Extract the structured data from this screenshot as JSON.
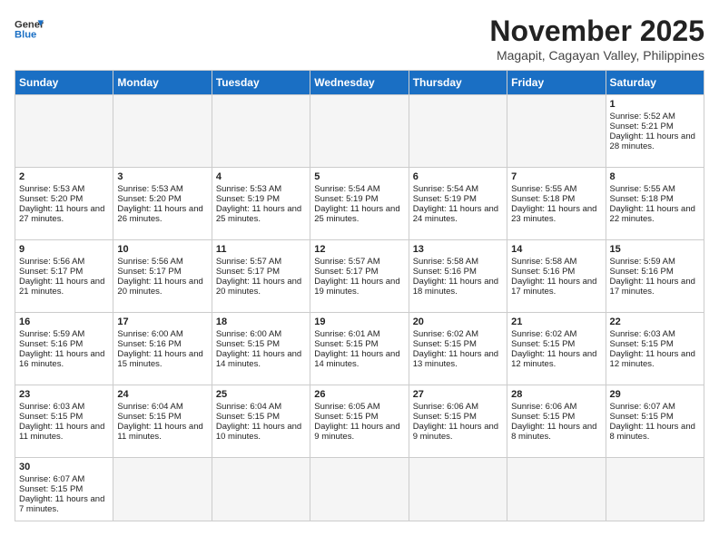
{
  "header": {
    "logo_general": "General",
    "logo_blue": "Blue",
    "month_year": "November 2025",
    "location": "Magapit, Cagayan Valley, Philippines"
  },
  "days_of_week": [
    "Sunday",
    "Monday",
    "Tuesday",
    "Wednesday",
    "Thursday",
    "Friday",
    "Saturday"
  ],
  "weeks": [
    [
      {
        "day": "",
        "empty": true
      },
      {
        "day": "",
        "empty": true
      },
      {
        "day": "",
        "empty": true
      },
      {
        "day": "",
        "empty": true
      },
      {
        "day": "",
        "empty": true
      },
      {
        "day": "",
        "empty": true
      },
      {
        "day": "1",
        "sunrise": "5:52 AM",
        "sunset": "5:21 PM",
        "daylight": "11 hours and 28 minutes."
      }
    ],
    [
      {
        "day": "2",
        "sunrise": "5:53 AM",
        "sunset": "5:20 PM",
        "daylight": "11 hours and 27 minutes."
      },
      {
        "day": "3",
        "sunrise": "5:53 AM",
        "sunset": "5:20 PM",
        "daylight": "11 hours and 26 minutes."
      },
      {
        "day": "4",
        "sunrise": "5:53 AM",
        "sunset": "5:19 PM",
        "daylight": "11 hours and 25 minutes."
      },
      {
        "day": "5",
        "sunrise": "5:54 AM",
        "sunset": "5:19 PM",
        "daylight": "11 hours and 25 minutes."
      },
      {
        "day": "6",
        "sunrise": "5:54 AM",
        "sunset": "5:19 PM",
        "daylight": "11 hours and 24 minutes."
      },
      {
        "day": "7",
        "sunrise": "5:55 AM",
        "sunset": "5:18 PM",
        "daylight": "11 hours and 23 minutes."
      },
      {
        "day": "8",
        "sunrise": "5:55 AM",
        "sunset": "5:18 PM",
        "daylight": "11 hours and 22 minutes."
      }
    ],
    [
      {
        "day": "9",
        "sunrise": "5:56 AM",
        "sunset": "5:17 PM",
        "daylight": "11 hours and 21 minutes."
      },
      {
        "day": "10",
        "sunrise": "5:56 AM",
        "sunset": "5:17 PM",
        "daylight": "11 hours and 20 minutes."
      },
      {
        "day": "11",
        "sunrise": "5:57 AM",
        "sunset": "5:17 PM",
        "daylight": "11 hours and 20 minutes."
      },
      {
        "day": "12",
        "sunrise": "5:57 AM",
        "sunset": "5:17 PM",
        "daylight": "11 hours and 19 minutes."
      },
      {
        "day": "13",
        "sunrise": "5:58 AM",
        "sunset": "5:16 PM",
        "daylight": "11 hours and 18 minutes."
      },
      {
        "day": "14",
        "sunrise": "5:58 AM",
        "sunset": "5:16 PM",
        "daylight": "11 hours and 17 minutes."
      },
      {
        "day": "15",
        "sunrise": "5:59 AM",
        "sunset": "5:16 PM",
        "daylight": "11 hours and 17 minutes."
      }
    ],
    [
      {
        "day": "16",
        "sunrise": "5:59 AM",
        "sunset": "5:16 PM",
        "daylight": "11 hours and 16 minutes."
      },
      {
        "day": "17",
        "sunrise": "6:00 AM",
        "sunset": "5:16 PM",
        "daylight": "11 hours and 15 minutes."
      },
      {
        "day": "18",
        "sunrise": "6:00 AM",
        "sunset": "5:15 PM",
        "daylight": "11 hours and 14 minutes."
      },
      {
        "day": "19",
        "sunrise": "6:01 AM",
        "sunset": "5:15 PM",
        "daylight": "11 hours and 14 minutes."
      },
      {
        "day": "20",
        "sunrise": "6:02 AM",
        "sunset": "5:15 PM",
        "daylight": "11 hours and 13 minutes."
      },
      {
        "day": "21",
        "sunrise": "6:02 AM",
        "sunset": "5:15 PM",
        "daylight": "11 hours and 12 minutes."
      },
      {
        "day": "22",
        "sunrise": "6:03 AM",
        "sunset": "5:15 PM",
        "daylight": "11 hours and 12 minutes."
      }
    ],
    [
      {
        "day": "23",
        "sunrise": "6:03 AM",
        "sunset": "5:15 PM",
        "daylight": "11 hours and 11 minutes."
      },
      {
        "day": "24",
        "sunrise": "6:04 AM",
        "sunset": "5:15 PM",
        "daylight": "11 hours and 11 minutes."
      },
      {
        "day": "25",
        "sunrise": "6:04 AM",
        "sunset": "5:15 PM",
        "daylight": "11 hours and 10 minutes."
      },
      {
        "day": "26",
        "sunrise": "6:05 AM",
        "sunset": "5:15 PM",
        "daylight": "11 hours and 9 minutes."
      },
      {
        "day": "27",
        "sunrise": "6:06 AM",
        "sunset": "5:15 PM",
        "daylight": "11 hours and 9 minutes."
      },
      {
        "day": "28",
        "sunrise": "6:06 AM",
        "sunset": "5:15 PM",
        "daylight": "11 hours and 8 minutes."
      },
      {
        "day": "29",
        "sunrise": "6:07 AM",
        "sunset": "5:15 PM",
        "daylight": "11 hours and 8 minutes."
      }
    ],
    [
      {
        "day": "30",
        "sunrise": "6:07 AM",
        "sunset": "5:15 PM",
        "daylight": "11 hours and 7 minutes."
      },
      {
        "day": "",
        "empty": true
      },
      {
        "day": "",
        "empty": true
      },
      {
        "day": "",
        "empty": true
      },
      {
        "day": "",
        "empty": true
      },
      {
        "day": "",
        "empty": true
      },
      {
        "day": "",
        "empty": true
      }
    ]
  ],
  "labels": {
    "sunrise": "Sunrise:",
    "sunset": "Sunset:",
    "daylight": "Daylight:"
  }
}
